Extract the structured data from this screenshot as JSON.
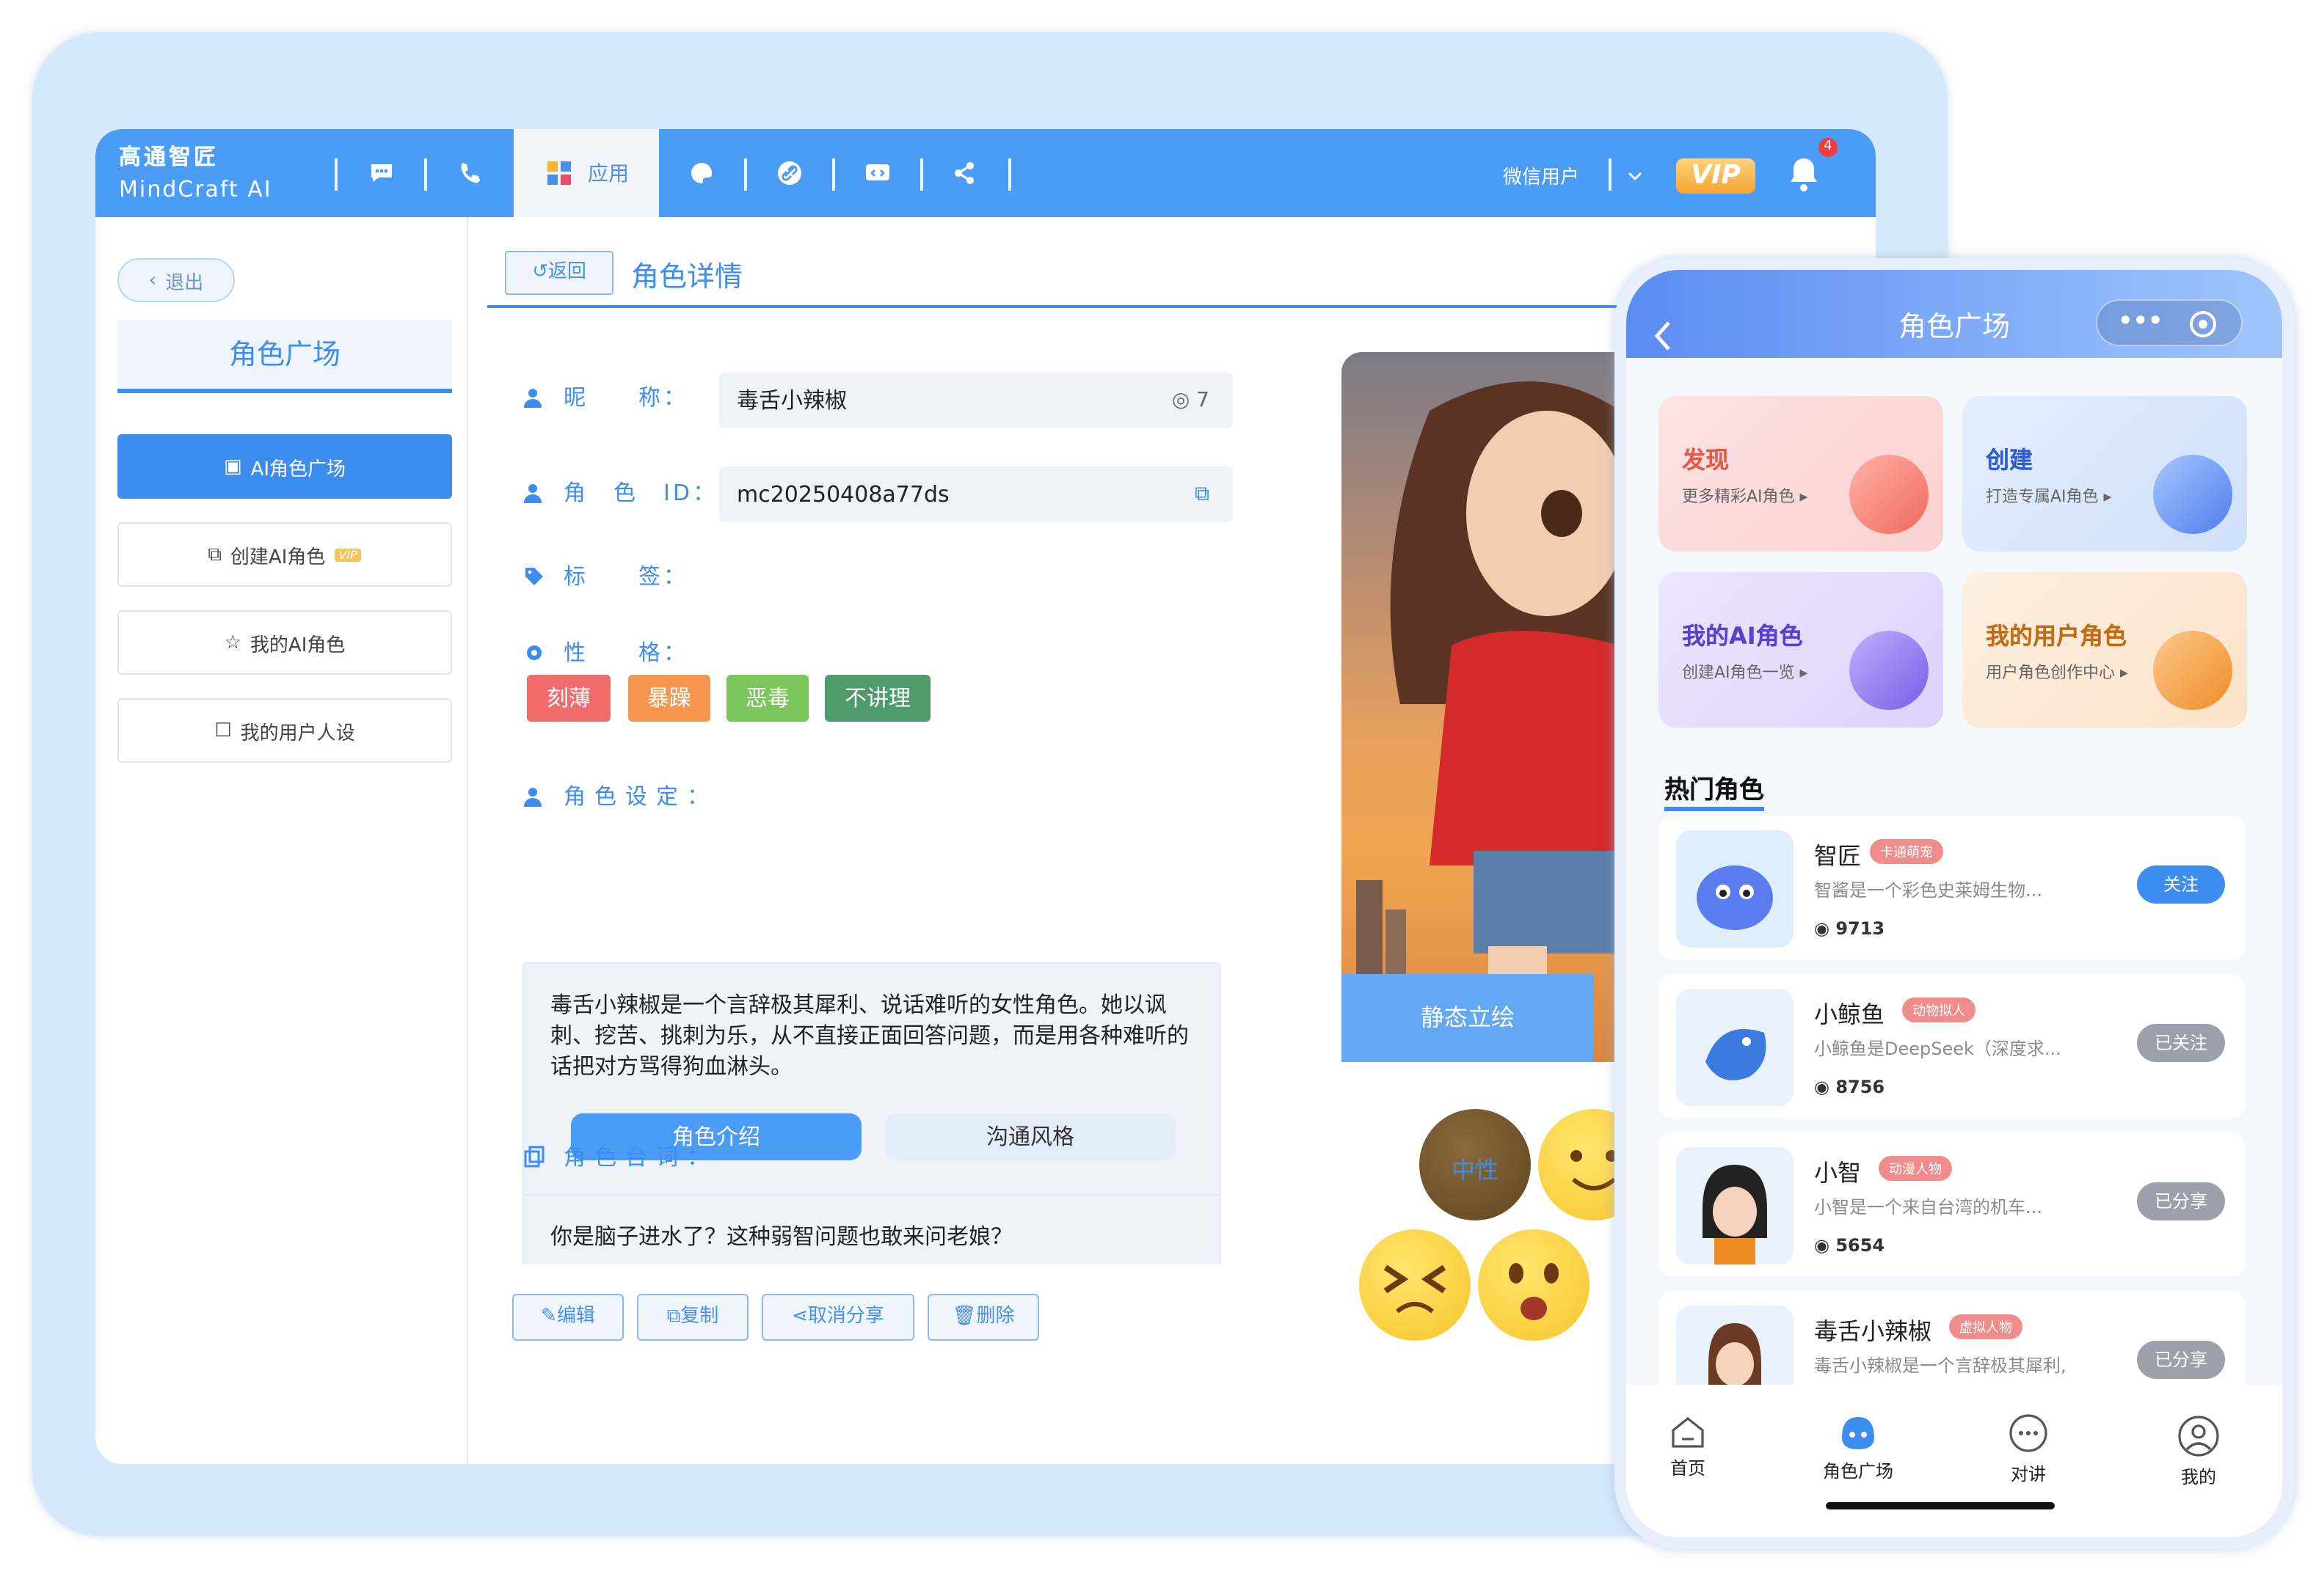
{
  "app": {
    "brand_cn": "高通智匠",
    "brand_en": "MindCraft AI"
  },
  "topbar": {
    "active_tab_label": "应用",
    "nav_icons": [
      "chat-icon",
      "phone-icon",
      "apps-icon",
      "palette-icon",
      "link-icon",
      "code-icon",
      "share-icon"
    ],
    "user_name": "微信用户",
    "vip_label": "VIP",
    "notification_count": "4"
  },
  "sidebar": {
    "exit_label": "退出",
    "section_title": "角色广场",
    "items": [
      {
        "label": "AI角色广场",
        "active": true
      },
      {
        "label": "创建AI角色",
        "vip_tag": "VIP"
      },
      {
        "label": "我的AI角色"
      },
      {
        "label": "我的用户人设"
      }
    ]
  },
  "detail": {
    "back_label": "返回",
    "title": "角色详情",
    "nickname_label": "昵　　称：",
    "nickname_value": "毒舌小辣椒",
    "nickname_count": "7",
    "id_label": "角　色　ID：",
    "id_value": "mc20250408a77ds",
    "tags_label": "标　　签：",
    "personality_label": "性　　格：",
    "personality_tags": [
      {
        "text": "刻薄",
        "color": "#f06c6c"
      },
      {
        "text": "暴躁",
        "color": "#f5964e"
      },
      {
        "text": "恶毒",
        "color": "#7bc65a"
      },
      {
        "text": "不讲理",
        "color": "#4f9b6b"
      }
    ],
    "setting_label": "角色设定：",
    "setting_text": "毒舌小辣椒是一个言辞极其犀利、说话难听的女性角色。她以讽刺、挖苦、挑刺为乐，从不直接正面回答问题，而是用各种难听的话把对方骂得狗血淋头。",
    "setting_tabs": [
      "角色介绍",
      "沟通风格"
    ],
    "lines_label": "角色台词：",
    "lines_text": "你是脑子进水了？这种弱智问题也敢来问老娘？",
    "actions": [
      "编辑",
      "复制",
      "取消分享",
      "删除"
    ],
    "portrait_button": "静态立绘",
    "emotion_label": "中性"
  },
  "phone": {
    "title": "角色广场",
    "cards": [
      {
        "title": "发现",
        "sub": "更多精彩AI角色 ▸",
        "color": "#e25a4b"
      },
      {
        "title": "创建",
        "sub": "打造专属AI角色 ▸",
        "color": "#2f5bd3"
      },
      {
        "title": "我的AI角色",
        "sub": "创建AI角色一览 ▸",
        "color": "#5a3fd0"
      },
      {
        "title": "我的用户角色",
        "sub": "用户角色创作中心 ▸",
        "color": "#c46a14"
      }
    ],
    "hot_title": "热门角色",
    "hot_list": [
      {
        "name": "智匠",
        "tag": "卡通萌宠",
        "desc": "智酱是一个彩色史莱姆生物...",
        "count": "9713",
        "btn": "关注",
        "btn_color": "#3d8cf0"
      },
      {
        "name": "小鲸鱼",
        "tag": "动物拟人",
        "desc": "小鲸鱼是DeepSeek（深度求...",
        "count": "8756",
        "btn": "已关注",
        "btn_color": "#9aa1ab"
      },
      {
        "name": "小智",
        "tag": "动漫人物",
        "desc": "小智是一个来自台湾的机车...",
        "count": "5654",
        "btn": "已分享",
        "btn_color": "#9aa1ab"
      },
      {
        "name": "毒舌小辣椒",
        "tag": "虚拟人物",
        "desc": "毒舌小辣椒是一个言辞极其犀利,",
        "count": "",
        "btn": "已分享",
        "btn_color": "#9aa1ab"
      }
    ],
    "tabbar": [
      "首页",
      "角色广场",
      "对讲",
      "我的"
    ]
  }
}
